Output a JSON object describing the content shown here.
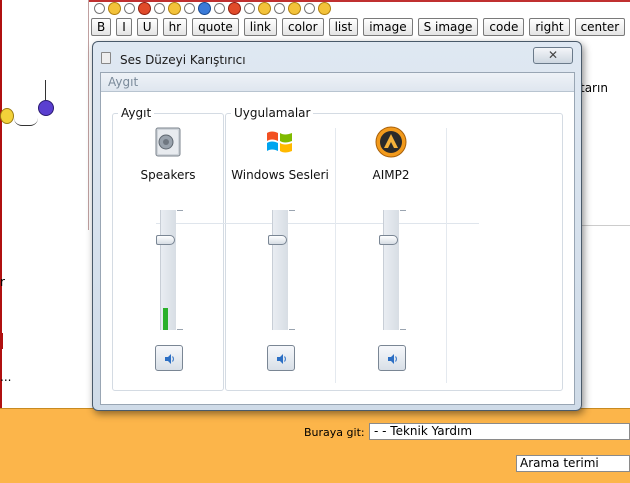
{
  "page": {
    "toolbar": {
      "buttons": [
        "B",
        "I",
        "U",
        "hr",
        "quote",
        "link",
        "color",
        "list",
        "image",
        "S image",
        "code",
        "right",
        "center"
      ]
    },
    "editor_text": "tarın",
    "left_text_1": "r",
    "left_text_2": "...",
    "goto_label": "Buraya git:",
    "goto_value": "- - Teknik Yardım",
    "search_value": "Arama terimi"
  },
  "mixer": {
    "title": "Ses Düzeyi Karıştırıcı",
    "close_label": "✕",
    "device_header": "Aygıt",
    "device_group_label": "Aygıt",
    "apps_group_label": "Uygulamalar",
    "channels": [
      {
        "name": "Speakers",
        "icon": "speaker-device-icon",
        "volume": 0.75,
        "meter": 0.18
      },
      {
        "name": "Windows Sesleri",
        "icon": "windows-logo-icon",
        "volume": 0.75,
        "meter": 0
      },
      {
        "name": "AIMP2",
        "icon": "aimp-icon",
        "volume": 0.75,
        "meter": 0
      }
    ]
  },
  "colors": {
    "bottom_bar": "#fcb54a",
    "meter_green": "#2ab02a",
    "window_frame": "#4a5a6a"
  }
}
